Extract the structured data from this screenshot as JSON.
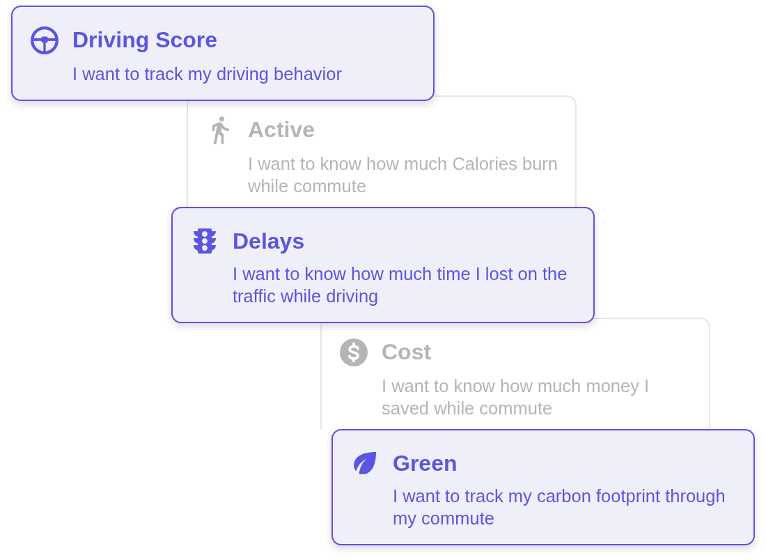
{
  "options": [
    {
      "title": "Driving Score",
      "description": "I want to track my driving behavior",
      "selected": true
    },
    {
      "title": "Active",
      "description": "I want to know how much Calories burn while commute",
      "selected": false
    },
    {
      "title": "Delays",
      "description": "I want to know how much time I lost on the traffic while driving",
      "selected": true
    },
    {
      "title": "Cost",
      "description": "I want to know how much money I saved while commute",
      "selected": false
    },
    {
      "title": "Green",
      "description": "I want to track my carbon footprint through my commute",
      "selected": true
    }
  ]
}
